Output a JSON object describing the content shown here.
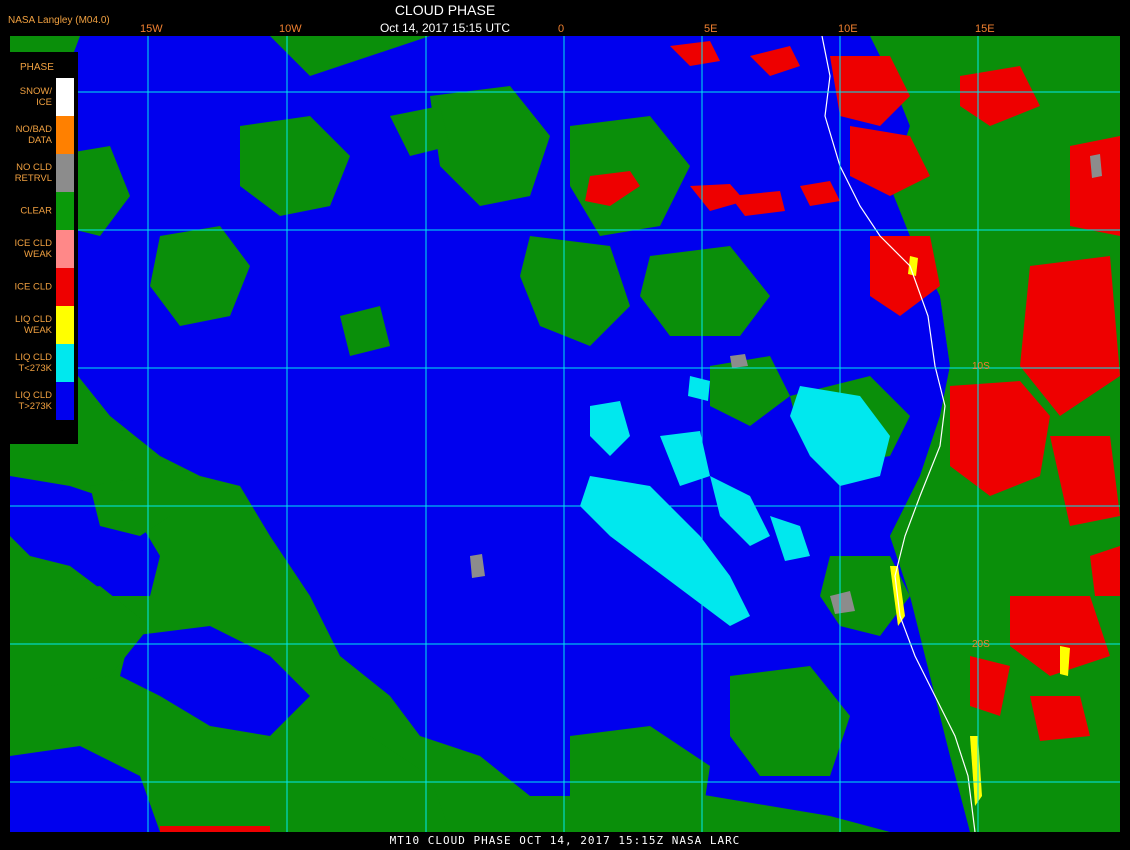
{
  "header": {
    "organization": "NASA Langley (M04.0)",
    "title": "CLOUD PHASE",
    "datetime": "Oct 14, 2017 15:15 UTC"
  },
  "map": {
    "longitude_labels": [
      "15W",
      "10W",
      "0",
      "5E",
      "10E",
      "15E"
    ],
    "latitude_labels": [
      "10S",
      "20S"
    ],
    "colors": {
      "clear": "#0a8f0a",
      "liq_warm": "#0000ee",
      "liq_cold": "#00e8ee",
      "liq_weak": "#ffff00",
      "ice": "#ee0000",
      "ice_weak": "#ff8888",
      "no_cloud_retrieval": "#888888",
      "no_data": "#ff8800",
      "snow_ice": "#ffffff",
      "grid": "#00e8ee",
      "coastline": "#ffffff"
    }
  },
  "legend": {
    "heading": "PHASE",
    "items": [
      {
        "label": "SNOW/\nICE",
        "color": "#ffffff"
      },
      {
        "label": "NO/BAD\nDATA",
        "color": "#ff8000"
      },
      {
        "label": "NO CLD\nRETRVL",
        "color": "#8c8c8c"
      },
      {
        "label": "CLEAR",
        "color": "#0a9a0a"
      },
      {
        "label": "ICE CLD\nWEAK",
        "color": "#ff8888"
      },
      {
        "label": "ICE CLD",
        "color": "#ee0000"
      },
      {
        "label": "LIQ CLD\nWEAK",
        "color": "#ffff00"
      },
      {
        "label": "LIQ CLD\nT<273K",
        "color": "#00e8ee"
      },
      {
        "label": "LIQ CLD\nT>273K",
        "color": "#0000ee"
      }
    ]
  },
  "footer": {
    "text": "MT10  CLOUD PHASE  OCT 14, 2017 15:15Z  NASA LARC"
  }
}
